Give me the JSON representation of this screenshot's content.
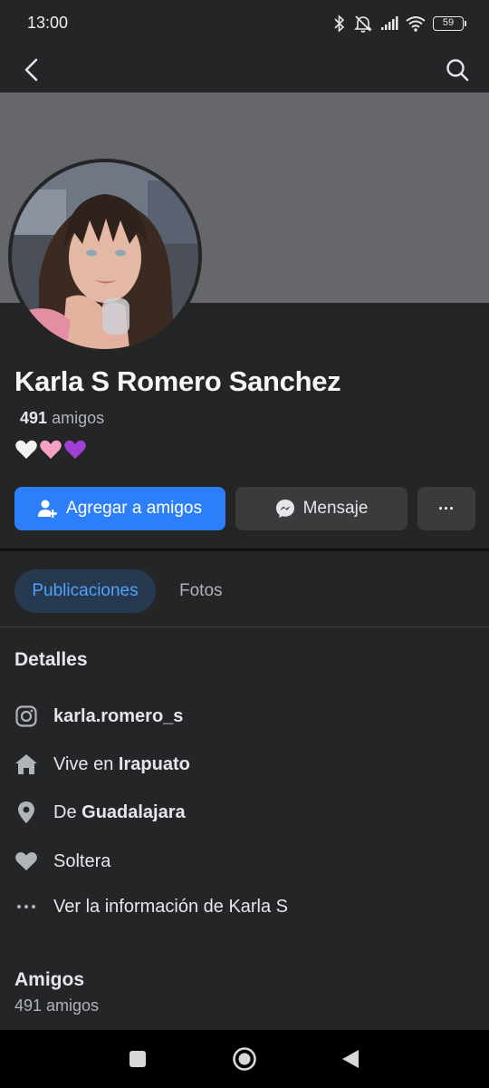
{
  "status_bar": {
    "time": "13:00",
    "battery": "59"
  },
  "nav": {
    "back_icon": "back-arrow-icon",
    "search_icon": "search-icon"
  },
  "colors": {
    "background": "#242527",
    "cover": "#65676b",
    "primary_button": "#2d7ff9",
    "secondary_button": "#3a3b3c",
    "active_tab_bg": "#263951",
    "active_tab_text": "#4ea2f7"
  },
  "profile": {
    "name": "Karla S Romero Sanchez",
    "friends_number": "491",
    "friends_word": "amigos",
    "bio_emojis": [
      "white-heart",
      "pink-heart",
      "purple-heart"
    ]
  },
  "actions": {
    "add_friend": "Agregar a amigos",
    "message": "Mensaje",
    "more": "···"
  },
  "tabs": [
    {
      "label": "Publicaciones",
      "active": true
    },
    {
      "label": "Fotos",
      "active": false
    }
  ],
  "details": {
    "title": "Detalles",
    "instagram": "karla.romero_s",
    "lives_prefix": "Vive en",
    "lives_place": "Irapuato",
    "from_prefix": "De",
    "from_place": "Guadalajara",
    "relationship": "Soltera",
    "see_more": "Ver la información de Karla S"
  },
  "friends_section": {
    "title": "Amigos",
    "count_text": "491 amigos"
  }
}
